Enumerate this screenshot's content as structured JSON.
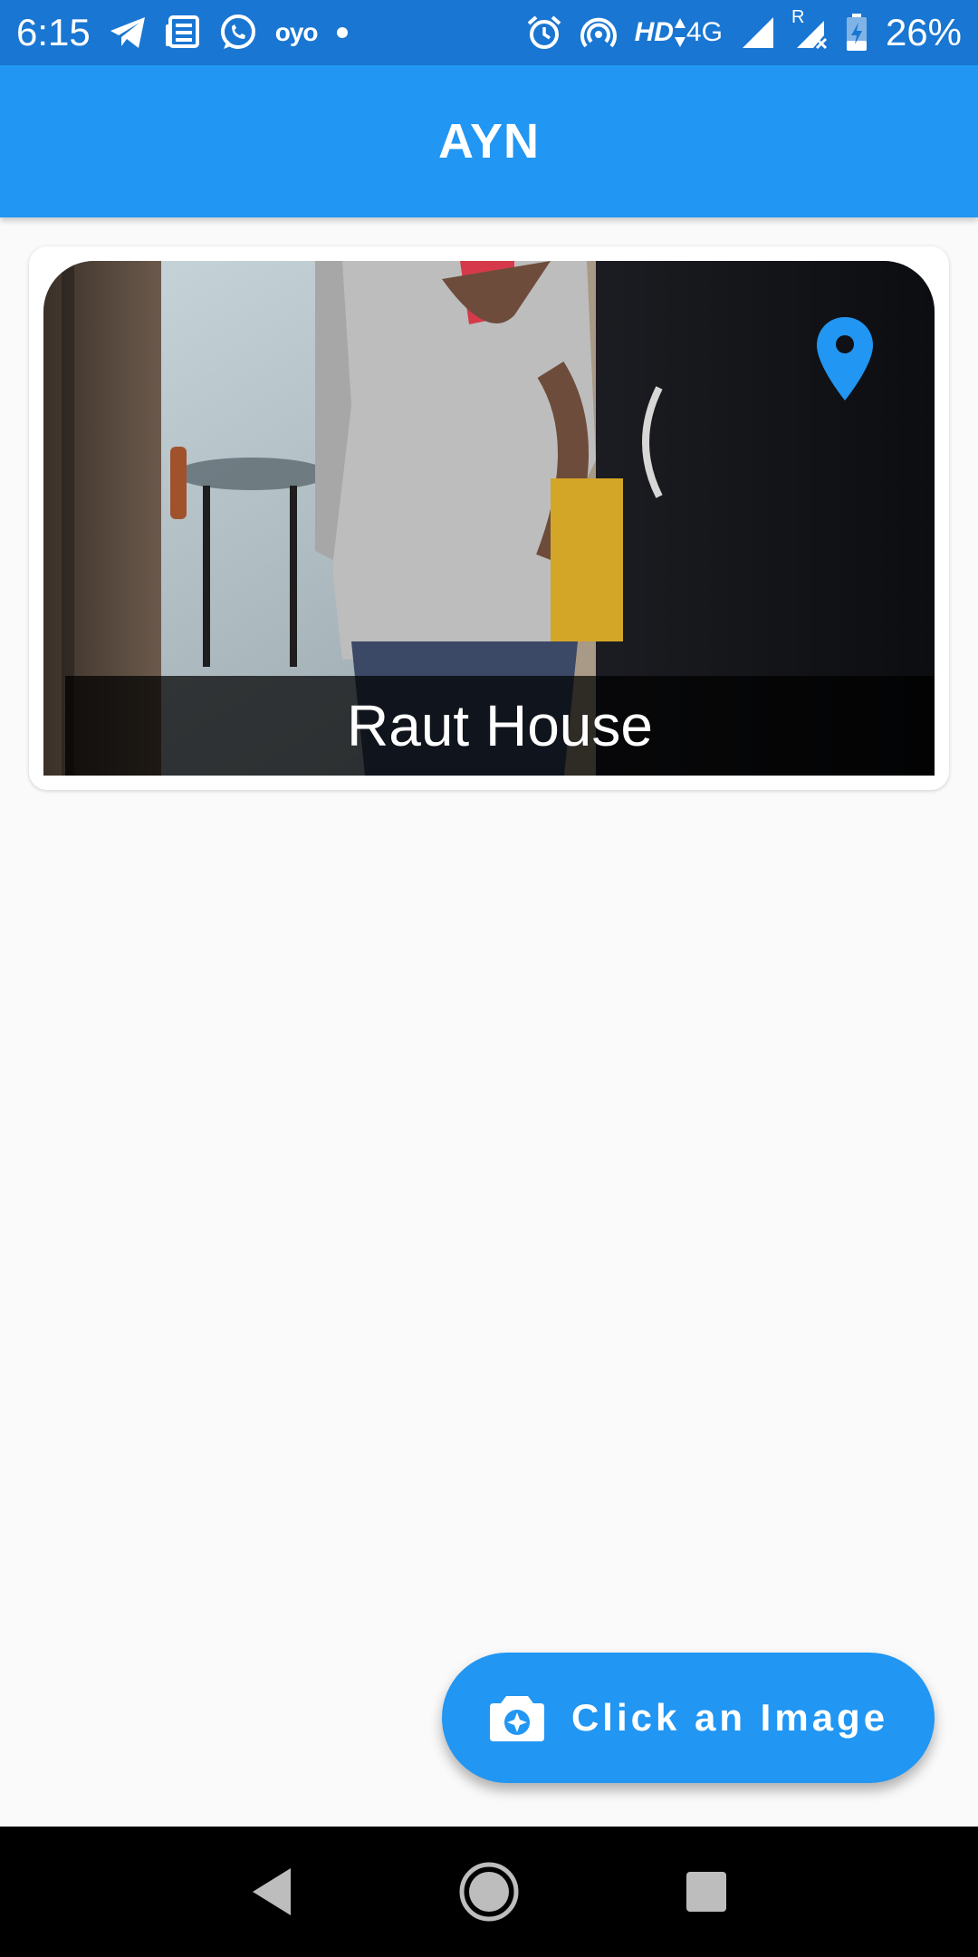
{
  "status_bar": {
    "time": "6:15",
    "oyo_label": "oyo",
    "network_label": "HD",
    "network_type": "4G",
    "roaming_label": "R",
    "battery": "26%",
    "icons": [
      "telegram-icon",
      "news-icon",
      "whatsapp-icon",
      "oyo-icon",
      "dot-icon",
      "alarm-icon",
      "hotspot-icon",
      "signal-icon",
      "roaming-signal-icon",
      "battery-charging-icon"
    ]
  },
  "app_bar": {
    "title": "AYN"
  },
  "card": {
    "caption": "Raut House",
    "pin_icon": "location-pin-icon"
  },
  "fab": {
    "label": "Click an Image",
    "icon": "camera-icon"
  },
  "nav_bar": {
    "icons": [
      "back-icon",
      "home-icon",
      "recents-icon"
    ]
  },
  "colors": {
    "status_bar": "#1976d2",
    "primary": "#2196f3",
    "background": "#fafafa",
    "nav_bar": "#000000"
  }
}
